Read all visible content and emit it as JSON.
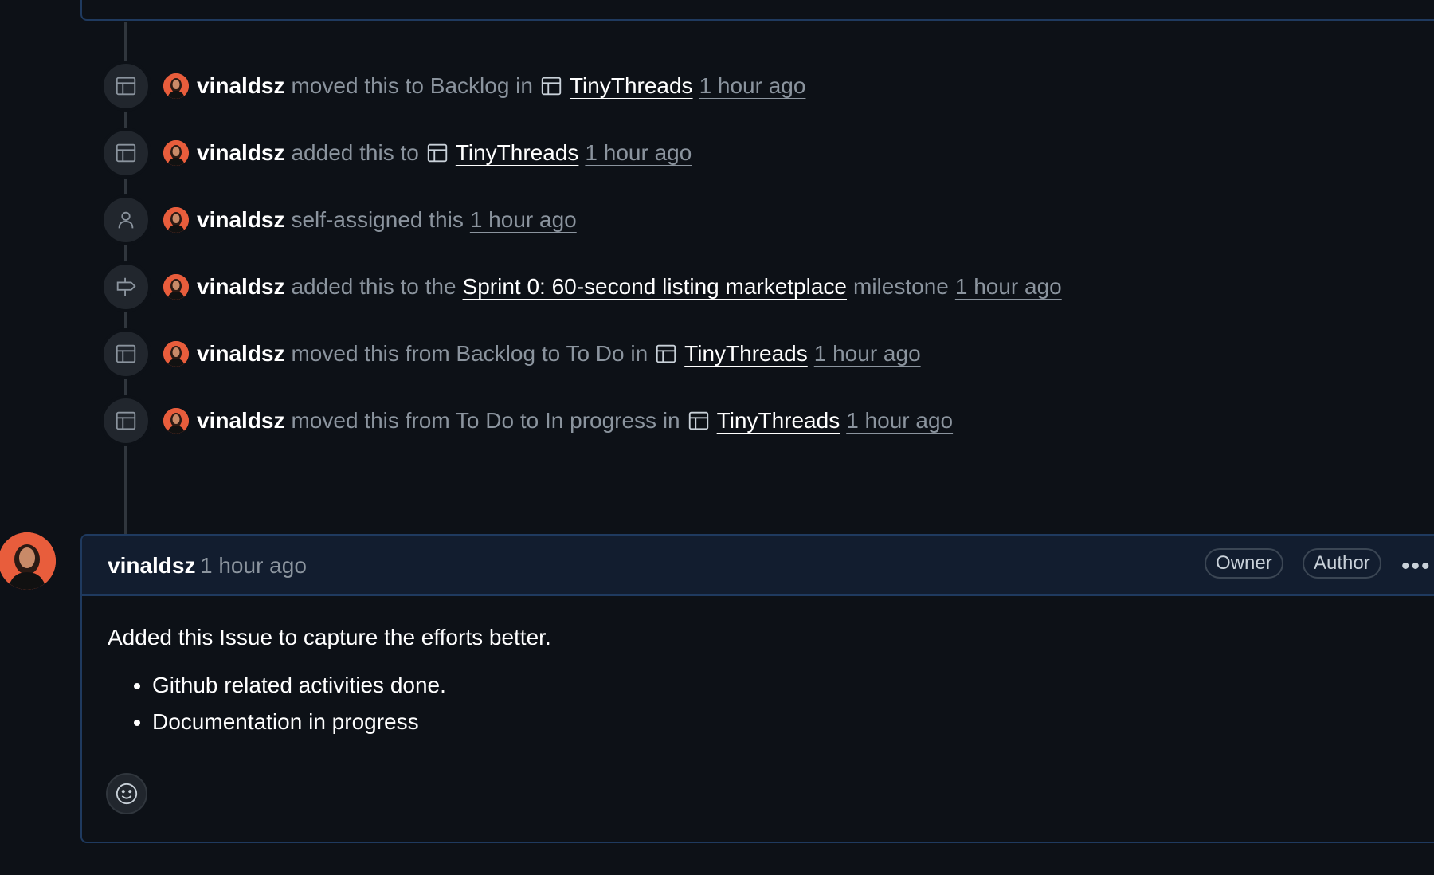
{
  "timeline": [
    {
      "actor": "vinaldsz",
      "parts": [
        "moved this to Backlog in"
      ],
      "project": "TinyThreads",
      "time": "1 hour ago",
      "icon": "project-table-icon"
    },
    {
      "actor": "vinaldsz",
      "parts": [
        "added this to"
      ],
      "project": "TinyThreads",
      "time": "1 hour ago",
      "icon": "project-table-icon"
    },
    {
      "actor": "vinaldsz",
      "parts": [
        "self-assigned this"
      ],
      "time": "1 hour ago",
      "icon": "person-icon"
    },
    {
      "actor": "vinaldsz",
      "parts": [
        "added this to the"
      ],
      "milestone": "Sprint 0: 60-second listing marketplace",
      "milestone_suffix": "milestone",
      "time": "1 hour ago",
      "icon": "milestone-icon"
    },
    {
      "actor": "vinaldsz",
      "parts": [
        "moved this from Backlog to To Do in"
      ],
      "project": "TinyThreads",
      "time": "1 hour ago",
      "icon": "project-table-icon"
    },
    {
      "actor": "vinaldsz",
      "parts": [
        "moved this from To Do to In progress in"
      ],
      "project": "TinyThreads",
      "time": "1 hour ago",
      "icon": "project-table-icon"
    }
  ],
  "comment": {
    "author": "vinaldsz",
    "time": "1 hour ago",
    "badges": [
      "Owner",
      "Author"
    ],
    "menu_icon": "kebab-horizontal-icon",
    "body": "Added this Issue to capture the efforts better.",
    "list": [
      "Github related activities done.",
      "Documentation in progress"
    ],
    "reaction_icon": "smiley-icon"
  },
  "colors": {
    "background": "#0d1117",
    "border": "#1f3a5f",
    "muted": "#8b949e",
    "avatar": "#e85d3c"
  }
}
